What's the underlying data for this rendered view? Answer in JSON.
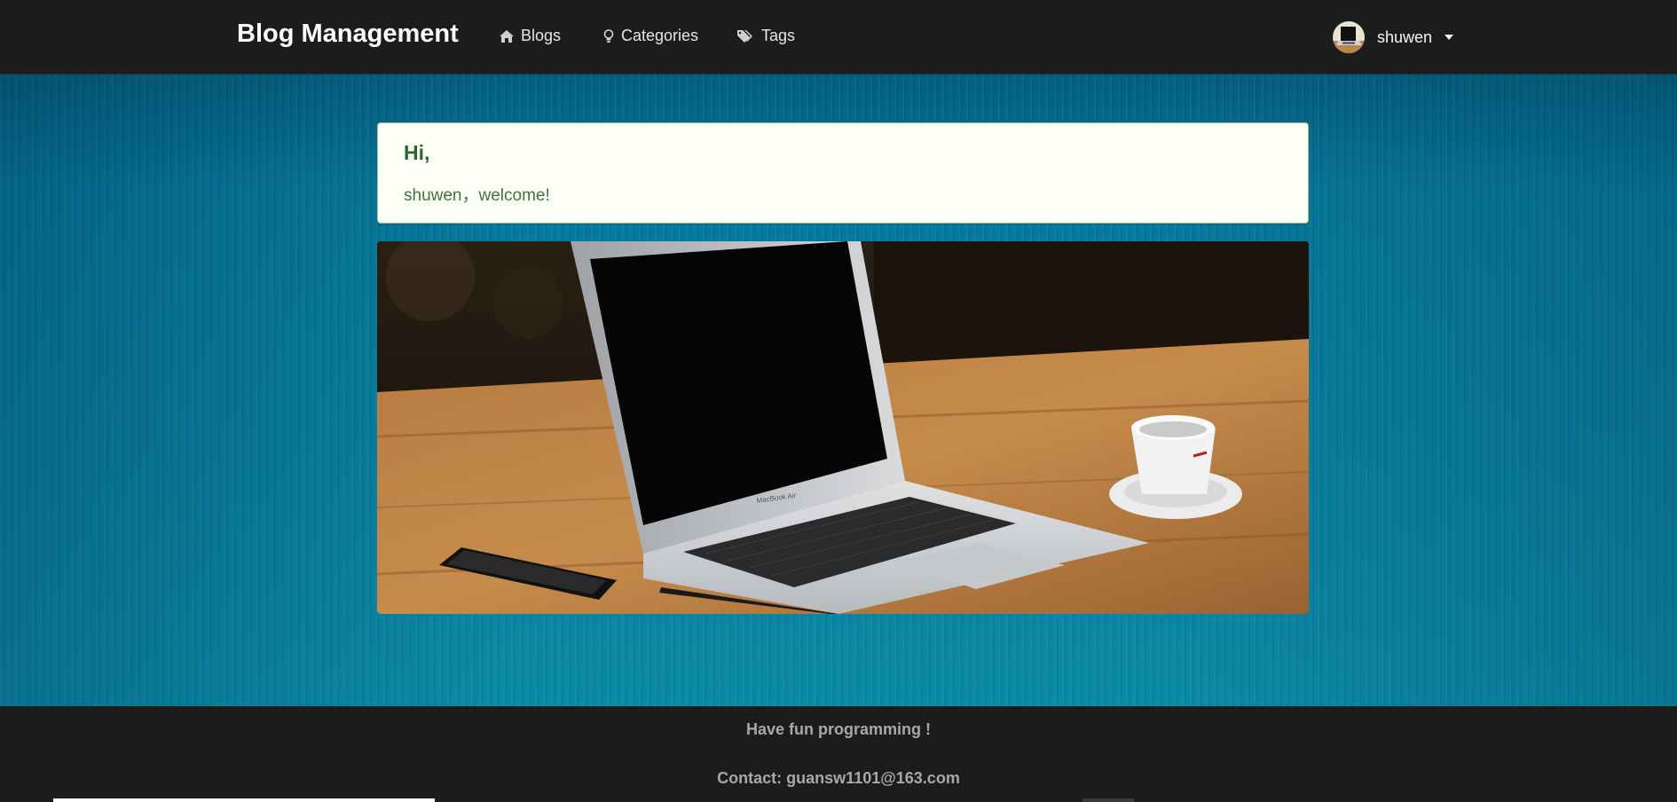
{
  "navbar": {
    "brand": "Blog Management",
    "items": [
      {
        "label": "Blogs",
        "icon": "home-icon"
      },
      {
        "label": "Categories",
        "icon": "lightbulb-icon"
      },
      {
        "label": "Tags",
        "icon": "tags-icon"
      }
    ],
    "user": {
      "name": "shuwen",
      "avatar_icon": "avatar",
      "menu_icon": "caret-down-icon"
    }
  },
  "welcome": {
    "header": "Hi,",
    "text": "shuwen，welcome!"
  },
  "hero": {
    "image": "laptop-on-desk-photo"
  },
  "footer": {
    "tagline": "Have fun programming !",
    "contact": "Contact: guansw1101@163.com"
  },
  "colors": {
    "navbar_bg": "#1b1c1d",
    "hero_bg": "#08809f",
    "welcome_bg": "#fcfff5",
    "welcome_text": "#2c662d",
    "footer_text": "#a8a8a8"
  }
}
